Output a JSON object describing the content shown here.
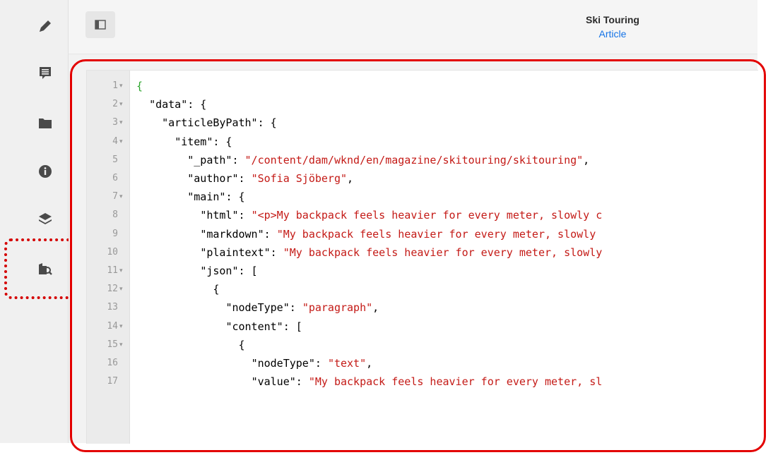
{
  "rail": {
    "items": [
      {
        "name": "edit-icon"
      },
      {
        "name": "comments-icon"
      },
      {
        "name": "folder-icon"
      },
      {
        "name": "info-icon"
      },
      {
        "name": "layers-icon"
      },
      {
        "name": "json-preview-icon"
      }
    ]
  },
  "header": {
    "title": "Ski Touring",
    "subtitle": "Article"
  },
  "editor": {
    "lines": [
      {
        "num": "1",
        "fold": true,
        "indent": "",
        "key": "",
        "value": "",
        "text": "{"
      },
      {
        "num": "2",
        "fold": true,
        "indent": "  ",
        "key": "\"data\"",
        "value": "",
        "text": ": {"
      },
      {
        "num": "3",
        "fold": true,
        "indent": "    ",
        "key": "\"articleByPath\"",
        "value": "",
        "text": ": {"
      },
      {
        "num": "4",
        "fold": true,
        "indent": "      ",
        "key": "\"item\"",
        "value": "",
        "text": ": {"
      },
      {
        "num": "5",
        "fold": false,
        "indent": "        ",
        "key": "\"_path\"",
        "value": "\"/content/dam/wknd/en/magazine/skitouring/skitouring\"",
        "text": ","
      },
      {
        "num": "6",
        "fold": false,
        "indent": "        ",
        "key": "\"author\"",
        "value": "\"Sofia Sjöberg\"",
        "text": ","
      },
      {
        "num": "7",
        "fold": true,
        "indent": "        ",
        "key": "\"main\"",
        "value": "",
        "text": ": {"
      },
      {
        "num": "8",
        "fold": false,
        "indent": "          ",
        "key": "\"html\"",
        "value": "\"<p>My backpack feels heavier for every meter, slowly c",
        "text": ""
      },
      {
        "num": "9",
        "fold": false,
        "indent": "          ",
        "key": "\"markdown\"",
        "value": "\"My backpack feels heavier for every meter, slowly",
        "text": ""
      },
      {
        "num": "10",
        "fold": false,
        "indent": "          ",
        "key": "\"plaintext\"",
        "value": "\"My backpack feels heavier for every meter, slowly",
        "text": ""
      },
      {
        "num": "11",
        "fold": true,
        "indent": "          ",
        "key": "\"json\"",
        "value": "",
        "text": ": ["
      },
      {
        "num": "12",
        "fold": true,
        "indent": "            ",
        "key": "",
        "value": "",
        "text": "{"
      },
      {
        "num": "13",
        "fold": false,
        "indent": "              ",
        "key": "\"nodeType\"",
        "value": "\"paragraph\"",
        "text": ","
      },
      {
        "num": "14",
        "fold": true,
        "indent": "              ",
        "key": "\"content\"",
        "value": "",
        "text": ": ["
      },
      {
        "num": "15",
        "fold": true,
        "indent": "                ",
        "key": "",
        "value": "",
        "text": "{"
      },
      {
        "num": "16",
        "fold": false,
        "indent": "                  ",
        "key": "\"nodeType\"",
        "value": "\"text\"",
        "text": ","
      },
      {
        "num": "17",
        "fold": false,
        "indent": "                  ",
        "key": "\"value\"",
        "value": "\"My backpack feels heavier for every meter, sl",
        "text": ""
      }
    ]
  },
  "colors": {
    "highlight": "#e30000",
    "string": "#c41a16",
    "link": "#1473e6"
  }
}
